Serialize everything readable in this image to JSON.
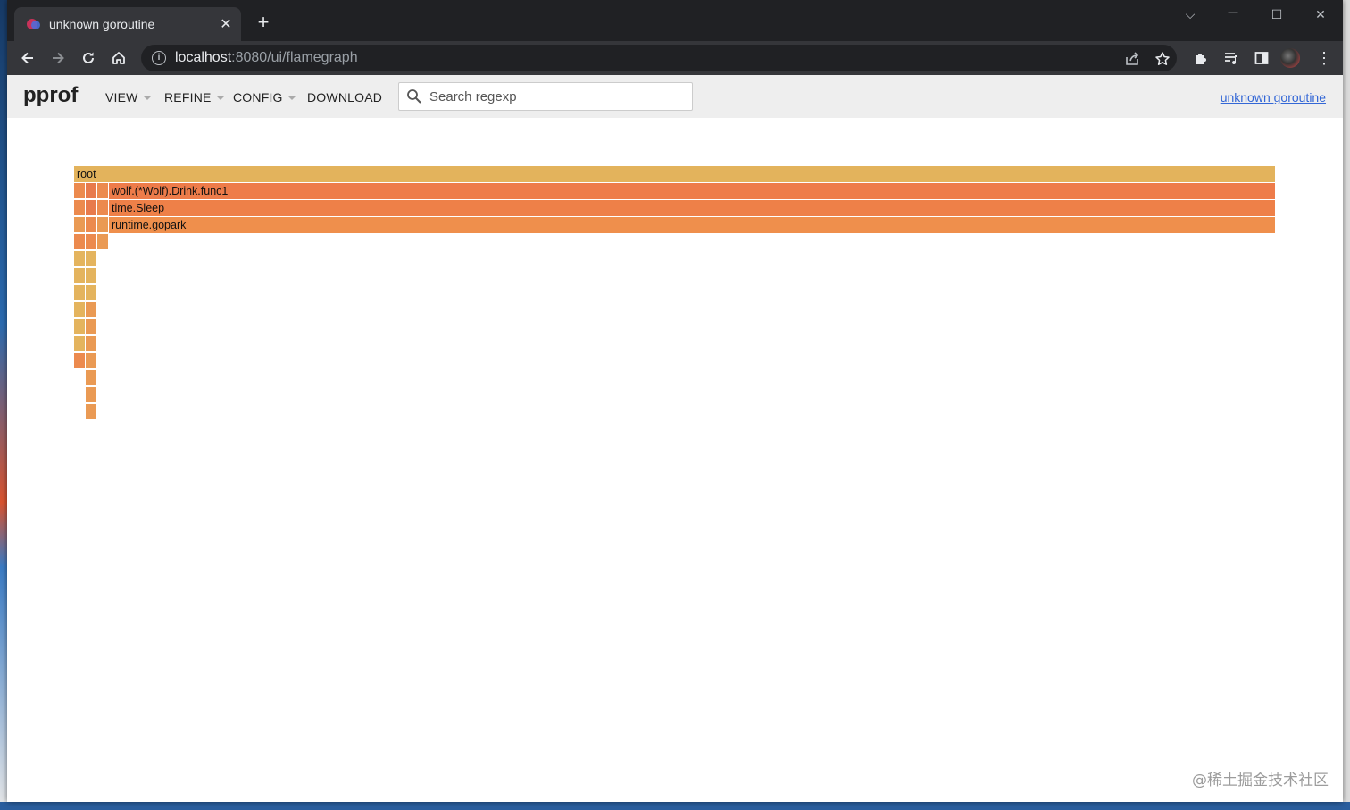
{
  "browser": {
    "tab_title": "unknown goroutine",
    "tab_close": "✕",
    "new_tab": "+",
    "url_host": "localhost",
    "url_rest": ":8080/ui/flamegraph",
    "win_chevron": "⌵",
    "win_minimize": "—",
    "win_maximize": "☐",
    "win_close": "✕",
    "menu": "⋮"
  },
  "pprof": {
    "title": "pprof",
    "menus": {
      "view": "VIEW",
      "refine": "REFINE",
      "config": "CONFIG",
      "download": "DOWNLOAD"
    },
    "search_placeholder": "Search regexp",
    "profile_link": "unknown goroutine"
  },
  "flamegraph": {
    "root": "root",
    "frames": [
      "wolf.(*Wolf).Drink.func1",
      "time.Sleep",
      "runtime.gopark"
    ]
  },
  "colors": {
    "root": "#e3b35c",
    "frame1": "#ee7c4a",
    "frame2": "#ee8048",
    "frame3": "#ef8f4c",
    "small_a": "#ec8a4e",
    "small_b": "#e4b45e",
    "small_c": "#ea9a54",
    "small_d": "#e87a4c"
  },
  "watermark": "@稀土掘金技术社区"
}
